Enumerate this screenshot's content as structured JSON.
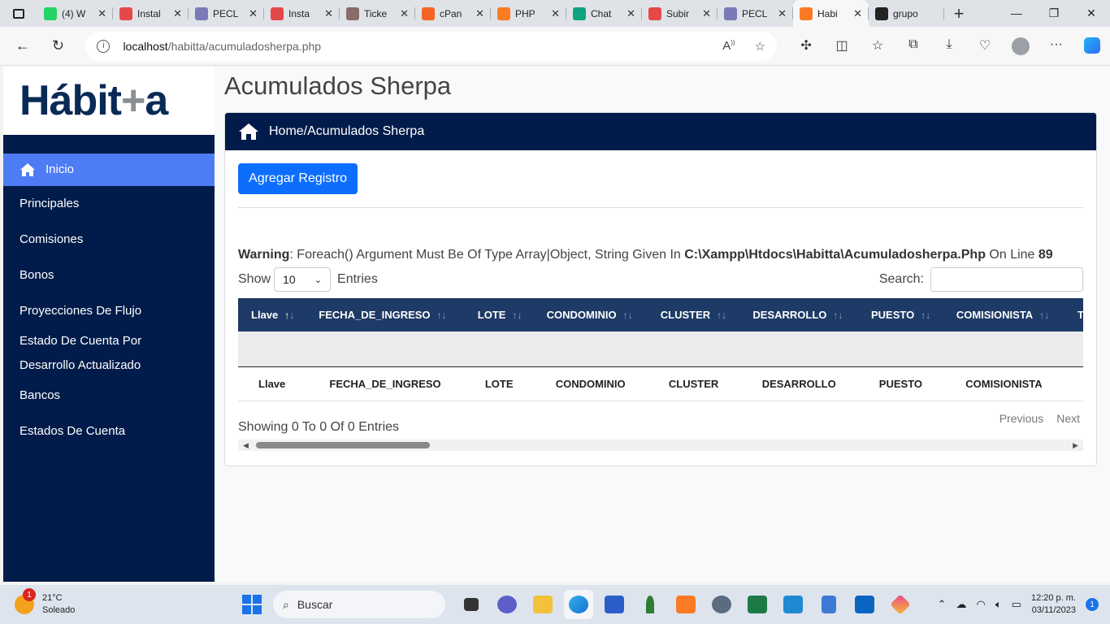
{
  "browser": {
    "tabs": [
      {
        "label": "(4) W",
        "icon": "whatsapp-icon",
        "color": "#25d366"
      },
      {
        "label": "Instal",
        "icon": "youtube-icon",
        "color": "#e54848"
      },
      {
        "label": "PECL",
        "icon": "feather-icon",
        "color": "#7a7ab8"
      },
      {
        "label": "Insta",
        "icon": "youtube-icon",
        "color": "#e54848"
      },
      {
        "label": "Ticke",
        "icon": "ticket-icon",
        "color": "#8a6b6b"
      },
      {
        "label": "cPan",
        "icon": "cpanel-icon",
        "color": "#f26522"
      },
      {
        "label": "PHP",
        "icon": "xampp-icon",
        "color": "#fb7a24"
      },
      {
        "label": "Chat",
        "icon": "chatgpt-icon",
        "color": "#10a37f"
      },
      {
        "label": "Subir",
        "icon": "youtube-icon",
        "color": "#e54848"
      },
      {
        "label": "PECL",
        "icon": "feather-icon",
        "color": "#7a7ab8"
      },
      {
        "label": "Habi",
        "icon": "xampp-icon",
        "color": "#fb7a24",
        "active": true
      },
      {
        "label": "grupo",
        "icon": "github-icon",
        "color": "#222222"
      }
    ],
    "url_host": "localhost",
    "url_path": "/habitta/acumuladosherpa.php"
  },
  "sidebar": {
    "logo_main": "Hábit",
    "logo_mark": "+",
    "logo_end": "a",
    "items": [
      {
        "label": "Inicio",
        "active": true
      },
      {
        "label": "Principales"
      },
      {
        "label": "Comisiones"
      },
      {
        "label": "Bonos"
      },
      {
        "label": "Proyecciones De Flujo"
      },
      {
        "label": "Estado De Cuenta Por Desarrollo Actualizado"
      },
      {
        "label": "Bancos"
      },
      {
        "label": "Estados De Cuenta"
      }
    ]
  },
  "main": {
    "title": "Acumulados Sherpa",
    "breadcrumb": "Home/Acumulados Sherpa",
    "add_button": "Agregar Registro",
    "warning_label": "Warning",
    "warning_message": ": Foreach() Argument Must Be Of Type Array|Object, String Given In ",
    "warning_file": "C:\\Xampp\\Htdocs\\Habitta\\Acumuladosherpa.Php",
    "warning_online": " On Line ",
    "warning_line": "89",
    "show_label": "Show",
    "entries_value": "10",
    "entries_label": "Entries",
    "search_label": "Search:",
    "columns": [
      "Llave",
      "FECHA_DE_INGRESO",
      "LOTE",
      "CONDOMINIO",
      "CLUSTER",
      "DESARROLLO",
      "PUESTO",
      "COMISIONISTA",
      "TOTAL"
    ],
    "info": "Showing 0 To 0 Of 0 Entries",
    "prev": "Previous",
    "next": "Next"
  },
  "taskbar": {
    "temp": "21°C",
    "weather": "Soleado",
    "weather_badge": "1",
    "search_placeholder": "Buscar",
    "time": "12:20 p. m.",
    "date": "03/11/2023",
    "notifications": "1"
  },
  "colors": {
    "sidebar_bg": "#011c4a",
    "active_item": "#4d7cf4",
    "header_bg": "#1e3a66",
    "primary_button": "#0d6efd"
  }
}
